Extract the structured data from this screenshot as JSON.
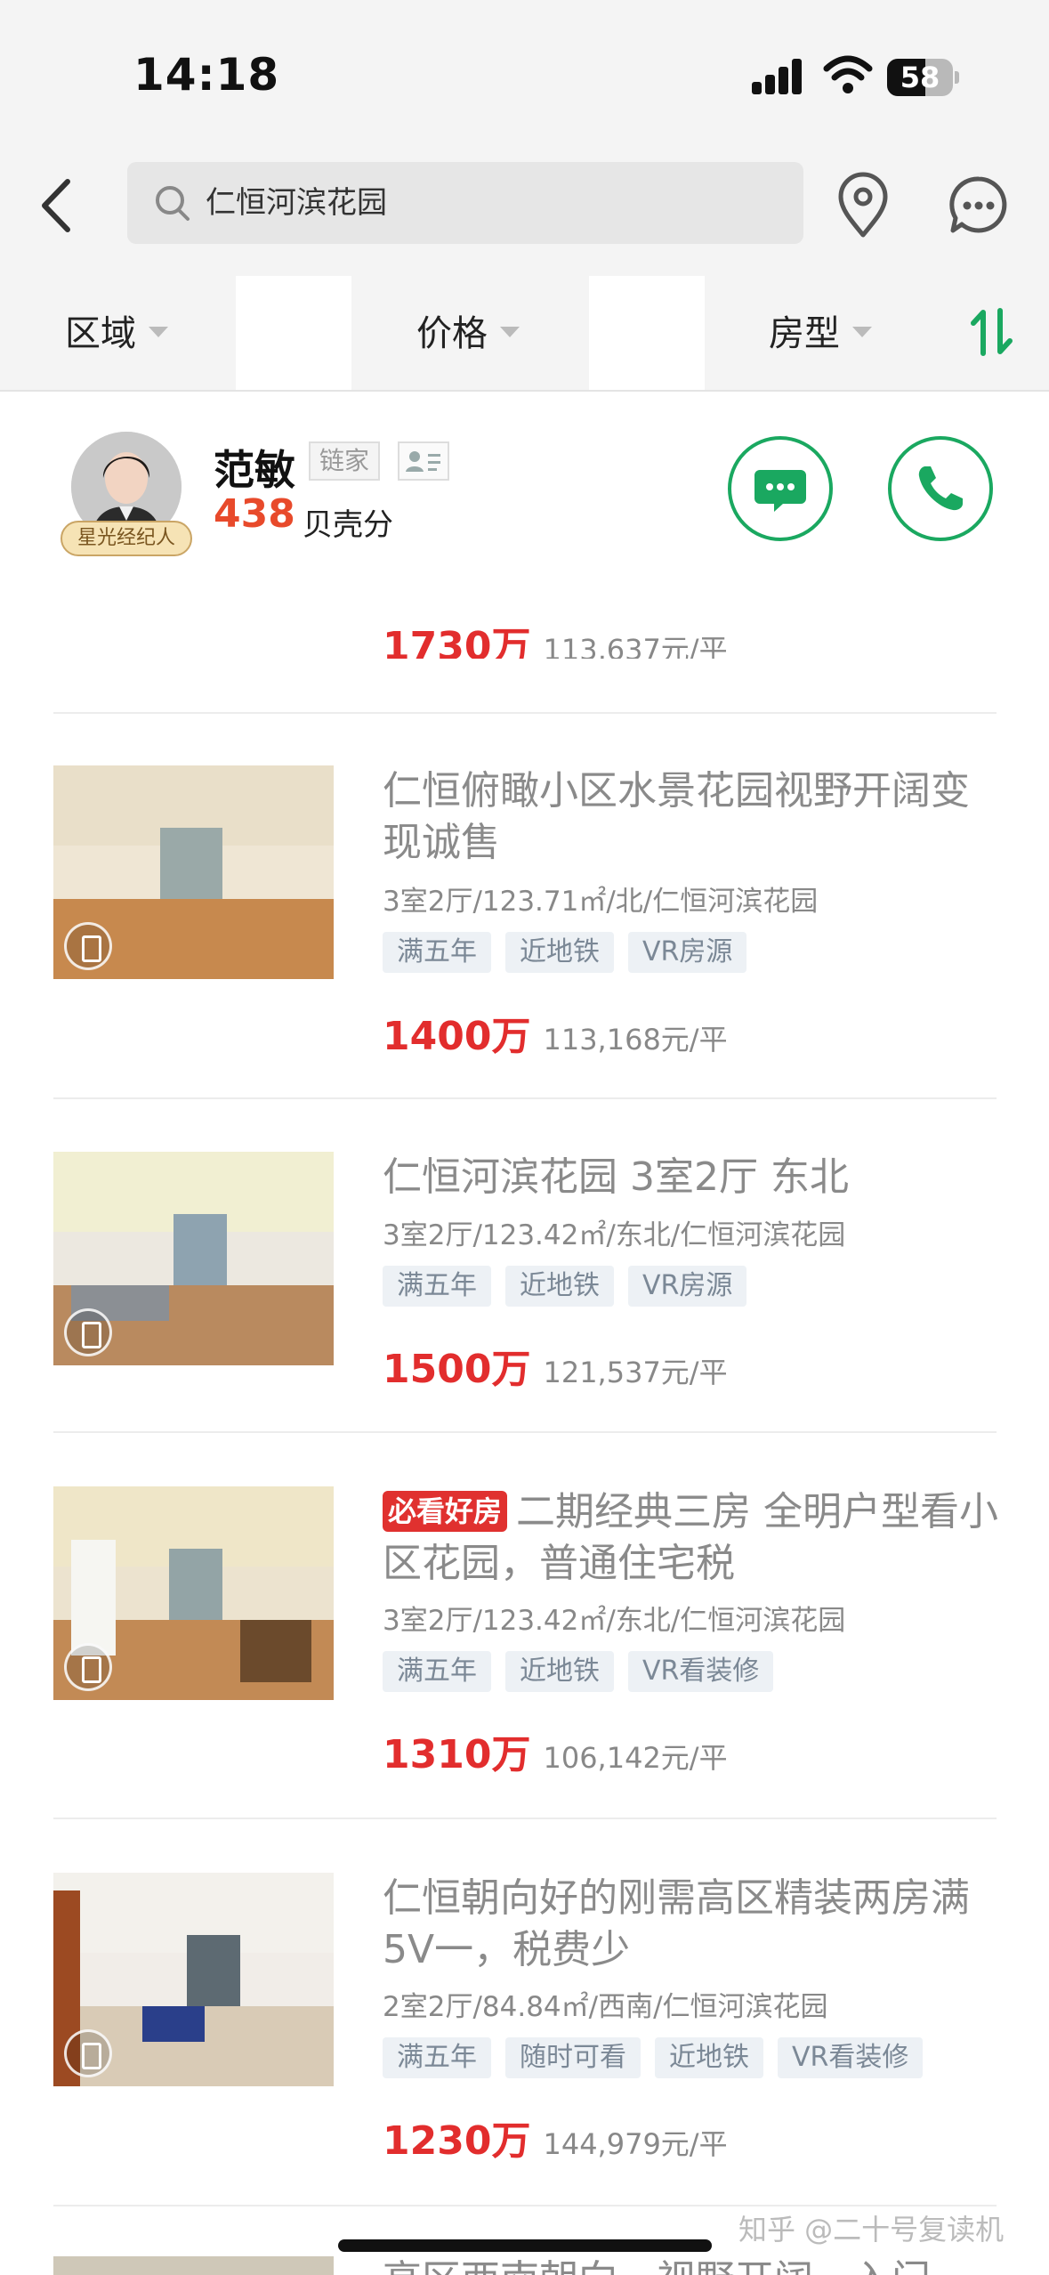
{
  "status_bar": {
    "time": "14:18",
    "battery": "58",
    "battery_level": 0.58
  },
  "header": {
    "search_text": "仁恒河滨花园"
  },
  "filters": [
    {
      "label": "区域"
    },
    {
      "label": "价格"
    },
    {
      "label": "房型"
    }
  ],
  "agent": {
    "name": "范敏",
    "company": "链家",
    "score": "438",
    "score_label": "贝壳分",
    "badge": "星光经纪人"
  },
  "partial_listing": {
    "price": "1730万",
    "unit_price": "113,637元/平"
  },
  "listings": [
    {
      "hot_tag": "",
      "title": "仁恒俯瞰小区水景花园视野开阔变现诚售",
      "info": "3室2厅/123.71㎡/北/仁恒河滨花园",
      "tags": [
        "满五年",
        "近地铁",
        "VR房源"
      ],
      "price": "1400万",
      "unit_price": "113,168元/平"
    },
    {
      "hot_tag": "",
      "title": "仁恒河滨花园 3室2厅 东北",
      "info": "3室2厅/123.42㎡/东北/仁恒河滨花园",
      "tags": [
        "满五年",
        "近地铁",
        "VR房源"
      ],
      "price": "1500万",
      "unit_price": "121,537元/平"
    },
    {
      "hot_tag": "必看好房",
      "title": "二期经典三房 全明户型看小区花园，普通住宅税",
      "info": "3室2厅/123.42㎡/东北/仁恒河滨花园",
      "tags": [
        "满五年",
        "近地铁",
        "VR看装修"
      ],
      "price": "1310万",
      "unit_price": "106,142元/平"
    },
    {
      "hot_tag": "",
      "title": "仁恒朝向好的刚需高区精装两房满5V一，税费少",
      "info": "2室2厅/84.84㎡/西南/仁恒河滨花园",
      "tags": [
        "满五年",
        "随时可看",
        "近地铁",
        "VR看装修"
      ],
      "price": "1230万",
      "unit_price": "144,979元/平"
    }
  ],
  "partial_bottom_title": "高区西南朝向，视野开阔，入门",
  "watermark": "知乎 @二十号复读机",
  "colors": {
    "accent_green": "#1aa860",
    "price_red": "#e22d2d",
    "score_orange": "#e84a2b"
  }
}
